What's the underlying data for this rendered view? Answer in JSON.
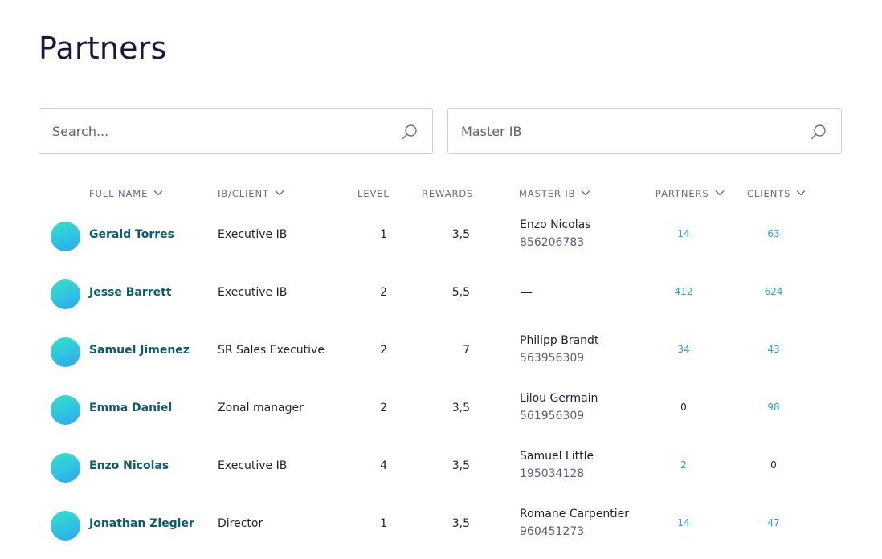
{
  "page": {
    "title": "Partners"
  },
  "search": {
    "placeholder": "Search...",
    "master_ib_value": "Master IB"
  },
  "columns": {
    "full_name": "FULL NAME",
    "ib_client": "IB/CLIENT",
    "level": "LEVEL",
    "rewards": "REWARDS",
    "master_ib": "MASTER IB",
    "partners": "PARTNERS",
    "clients": "CLIENTS"
  },
  "rows": [
    {
      "name": "Gerald Torres",
      "ib": "Executive IB",
      "level": "1",
      "rewards": "3,5",
      "master_name": "Enzo Nicolas",
      "master_id": "856206783",
      "partners": "14",
      "clients": "63"
    },
    {
      "name": "Jesse Barrett",
      "ib": "Executive IB",
      "level": "2",
      "rewards": "5,5",
      "master_dash": "—",
      "partners": "412",
      "clients": "624"
    },
    {
      "name": "Samuel Jimenez",
      "ib": "SR Sales Executive",
      "level": "2",
      "rewards": "7",
      "master_name": "Philipp Brandt",
      "master_id": "563956309",
      "partners": "34",
      "clients": "43"
    },
    {
      "name": "Emma Daniel",
      "ib": "Zonal manager",
      "level": "2",
      "rewards": "3,5",
      "master_name": "Lilou Germain",
      "master_id": "561956309",
      "partners": "0",
      "clients": "98"
    },
    {
      "name": "Enzo Nicolas",
      "ib": "Executive IB",
      "level": "4",
      "rewards": "3,5",
      "master_name": "Samuel Little",
      "master_id": "195034128",
      "partners": "2",
      "clients": "0"
    },
    {
      "name": "Jonathan Ziegler",
      "ib": "Director",
      "level": "1",
      "rewards": "3,5",
      "master_name": "Romane Carpentier",
      "master_id": "960451273",
      "partners": "14",
      "clients": "47"
    }
  ],
  "colors": {
    "accent_link": "#2aa0d6",
    "name_text": "#0c5a73",
    "avatar_gradient": [
      "#35e2c6",
      "#2aa7f0"
    ]
  },
  "icons": {
    "search": "search-icon",
    "sort": "chevron-down-icon",
    "avatar": "avatar"
  }
}
